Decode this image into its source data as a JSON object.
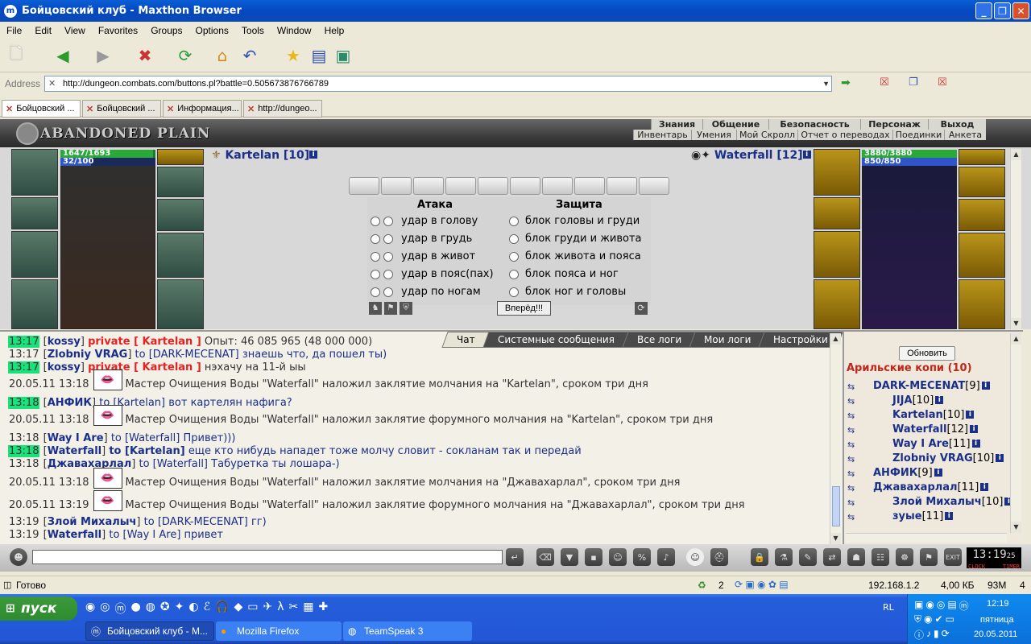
{
  "window": {
    "title": "Бойцовский клуб - Maxthon Browser"
  },
  "menu": [
    "File",
    "Edit",
    "View",
    "Favorites",
    "Groups",
    "Options",
    "Tools",
    "Window",
    "Help"
  ],
  "address": {
    "label": "Address",
    "url": "http://dungeon.combats.com/buttons.pl?battle=0.505673876766789"
  },
  "tabs": [
    "Бойцовский ...",
    "Бойцовский ...",
    "Информация...",
    "http://dungeo..."
  ],
  "game": {
    "location": "ABANDONED PLAIN",
    "nav_top": [
      "Знания",
      "Общение",
      "Безопасность",
      "Персонаж",
      "Выход"
    ],
    "nav_bottom": [
      "Инвентарь",
      "Умения",
      "Мой Скролл",
      "Отчет о переводах",
      "Поединки",
      "Анкета"
    ],
    "player": {
      "name": "Kartelan [10]",
      "hp": "1647/1693",
      "mana": "32/100",
      "hp_fill": 0.973,
      "mana_fill": 0.32
    },
    "enemy": {
      "name": "Waterfall [12]",
      "hp": "3880/3880",
      "mana": "850/850",
      "hp_fill": 1,
      "mana_fill": 1
    },
    "attack_header": "Атака",
    "defense_header": "Защита",
    "attacks": [
      "удар в голову",
      "удар в грудь",
      "удар в живот",
      "удар в пояс(пах)",
      "удар по ногам"
    ],
    "defenses": [
      "блок головы и груди",
      "блок груди и живота",
      "блок живота и пояса",
      "блок пояса и ног",
      "блок ног и головы"
    ],
    "forward_button": "Вперёд!!!"
  },
  "chat": {
    "tabs": [
      "Чат",
      "Системные сообщения",
      "Все логи",
      "Мои логи",
      "Настройки"
    ],
    "lines": [
      {
        "ts": "13:17",
        "hl": true,
        "nick": "kossy",
        "priv": "private [ Kartelan ]",
        "text": "Опыт: 46 085 965 (48 000 000)"
      },
      {
        "ts": "13:17",
        "hl": false,
        "nick": "Zlobniy VRAG",
        "to": "to [DARK-MECENAT]",
        "text": "знаешь что, да пошел ты)"
      },
      {
        "ts": "13:17",
        "hl": true,
        "nick": "kossy",
        "priv": "private [ Kartelan ]",
        "text": "нэхачу на 11-й ыы"
      },
      {
        "sys": true,
        "ts": "20.05.11 13:18",
        "text": "Мастер Очищения Воды \"Waterfall\" наложил заклятие молчания на \"Kartelan\", сроком три дня"
      },
      {
        "ts": "13:18",
        "hl": true,
        "nick": "АНФИК",
        "to": "to [Kartelan]",
        "text": "вот картелян нафига?"
      },
      {
        "sys": true,
        "ts": "20.05.11 13:18",
        "text": "Мастер Очищения Воды \"Waterfall\" наложил заклятие форумного молчания на \"Kartelan\", сроком три дня"
      },
      {
        "ts": "13:18",
        "hl": false,
        "nick": "Way I Are",
        "to": "to [Waterfall]",
        "text": "Привет)))",
        "plain": true
      },
      {
        "ts": "13:18",
        "hl": true,
        "nick": "Waterfall",
        "to": "to [Kartelan]",
        "text": "еще кто нибудь нападет тоже молчу словит - сокланам так и передай",
        "bold": true
      },
      {
        "ts": "13:18",
        "hl": false,
        "nick": "Джавахарлал",
        "to": "to [Waterfall]",
        "text": "Табуретка ты лошара-)"
      },
      {
        "sys": true,
        "ts": "20.05.11 13:18",
        "text": "Мастер Очищения Воды \"Waterfall\" наложил заклятие молчания на \"Джавахарлал\", сроком три дня"
      },
      {
        "sys": true,
        "ts": "20.05.11 13:19",
        "text": "Мастер Очищения Воды \"Waterfall\" наложил заклятие форумного молчания на \"Джавахарлал\", сроком три дня"
      },
      {
        "ts": "13:19",
        "hl": false,
        "nick": "Злой Михалыч",
        "to": "to [DARK-MECENAT]",
        "text": "гг)"
      },
      {
        "ts": "13:19",
        "hl": false,
        "nick": "Waterfall",
        "to": "to [Way I Are]",
        "text": "привет"
      }
    ]
  },
  "room": {
    "refresh": "Обновить",
    "title": "Арильские копи (10)",
    "players": [
      {
        "name": "DARK-MECENAT",
        "lv": "[9]"
      },
      {
        "name": "JIJA",
        "lv": "[10]"
      },
      {
        "name": "Kartelan",
        "lv": "[10]"
      },
      {
        "name": "Waterfall",
        "lv": "[12]"
      },
      {
        "name": "Way I Are",
        "lv": "[11]"
      },
      {
        "name": "Zlobniy VRAG",
        "lv": "[10]"
      },
      {
        "name": "АНФИК",
        "lv": "[9]"
      },
      {
        "name": "Джавахарлал",
        "lv": "[11]"
      },
      {
        "name": "Злой Михалыч",
        "lv": "[10]"
      },
      {
        "name": "зуые",
        "lv": "[11]"
      }
    ]
  },
  "clock": {
    "time": "13:19",
    "sec": "25",
    "labels": [
      "CLOCK",
      "TIMER"
    ]
  },
  "status": {
    "text": "Готово",
    "count": "2",
    "ip": "192.168.1.2",
    "speed": "4,00 КБ",
    "mem": "93M",
    "num": "4"
  },
  "taskbar": {
    "start": "пуск",
    "tasks": [
      "Бойцовский клуб - M...",
      "Mozilla Firefox",
      "TeamSpeak 3"
    ],
    "lang": "RL",
    "time": "12:19",
    "day": "пятница",
    "date": "20.05.2011"
  }
}
